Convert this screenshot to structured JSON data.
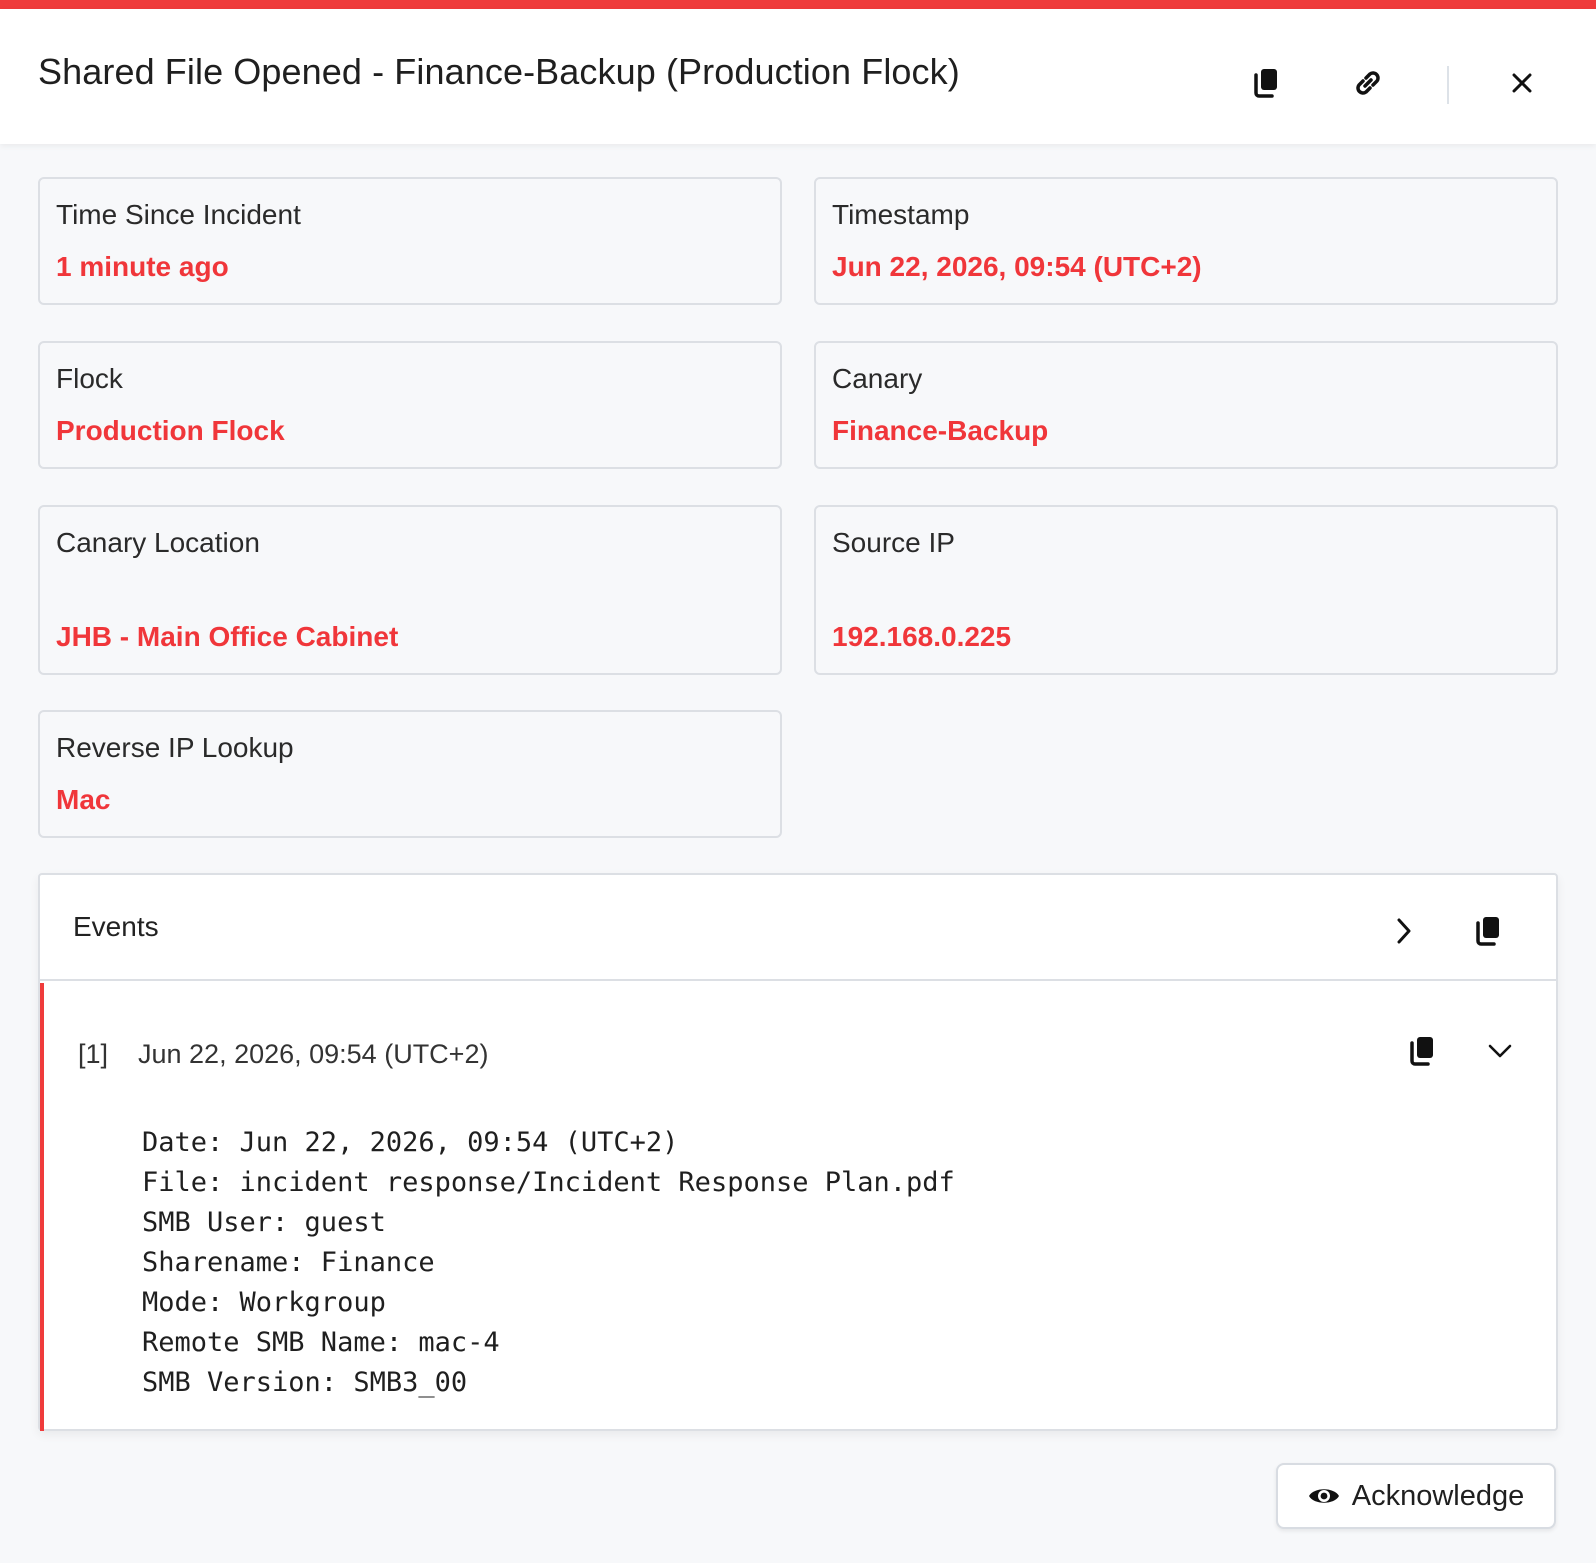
{
  "header": {
    "title": "Shared File Opened - Finance-Backup (Production Flock)",
    "copy_icon": "copy-icon",
    "link_icon": "link-icon",
    "close_icon": "close-icon"
  },
  "details": {
    "time_since_incident": {
      "label": "Time Since Incident",
      "value": "1 minute ago"
    },
    "timestamp": {
      "label": "Timestamp",
      "value": "Jun 22, 2026, 09:54 (UTC+2)"
    },
    "flock": {
      "label": "Flock",
      "value": "Production Flock"
    },
    "canary": {
      "label": "Canary",
      "value": "Finance-Backup"
    },
    "canary_location": {
      "label": "Canary Location",
      "value": "JHB - Main Office Cabinet"
    },
    "source_ip": {
      "label": "Source IP",
      "value": "192.168.0.225"
    },
    "reverse_ip_lookup": {
      "label": "Reverse IP Lookup",
      "value": "Mac"
    }
  },
  "events": {
    "title": "Events",
    "items": [
      {
        "index": "[1]",
        "time": "Jun 22, 2026, 09:54 (UTC+2)",
        "details": "Date: Jun 22, 2026, 09:54 (UTC+2)\nFile: incident response/Incident Response Plan.pdf\nSMB User: guest\nSharename: Finance\nMode: Workgroup\nRemote SMB Name: mac-4\nSMB Version: SMB3_00"
      }
    ]
  },
  "actions": {
    "acknowledge_label": "Acknowledge",
    "acknowledge_icon": "eye-icon"
  },
  "colors": {
    "accent": "#ef3b3b",
    "value_text": "#f0363a",
    "border": "#dcdfe4",
    "background": "#f7f8fa"
  }
}
